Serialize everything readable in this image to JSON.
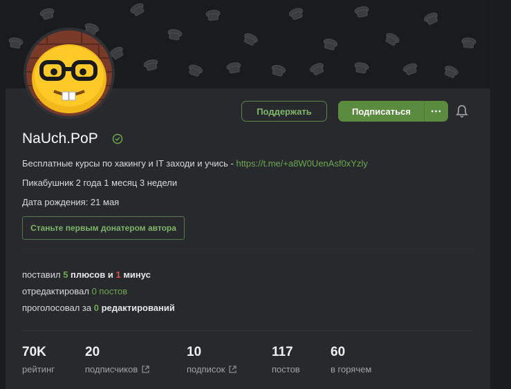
{
  "profile": {
    "name": "NaUch.PoP",
    "bio_text": "Бесплатные курсы по хакингу и IT заходи и учись - ",
    "bio_link": "https://t.me/+a8W0UenAsf0xYzly",
    "pikabu_age": "Пикабушник 2 года 1 месяц 3 недели",
    "birthday": "Дата рождения: 21 мая"
  },
  "buttons": {
    "donate": "Поддержать",
    "subscribe": "Подписаться",
    "more": "⋯",
    "first_donor": "Станьте первым донатером автора"
  },
  "activity": {
    "line1_prefix": "поставил ",
    "pluses_count": "5",
    "pluses_word": " плюсов",
    "and_word": " и ",
    "minus_count": "1",
    "minus_word": " минус",
    "line2_prefix": "отредактировал ",
    "edited_count": "0 постов",
    "line3_prefix": "проголосовал за ",
    "voted_count": "0",
    "voted_word": " редактирований"
  },
  "stats": [
    {
      "value": "70K",
      "label": "рейтинг"
    },
    {
      "value": "20",
      "label": "подписчиков"
    },
    {
      "value": "10",
      "label": "подписок"
    },
    {
      "value": "117",
      "label": "постов"
    },
    {
      "value": "60",
      "label": "в горячем"
    }
  ],
  "colors": {
    "accent_green": "#5a8b3e",
    "link_green": "#6ea850",
    "minus_red": "#e0524a"
  },
  "icons": {
    "bell": "bell-icon",
    "verified": "verified-icon",
    "external": "external-link-icon"
  }
}
